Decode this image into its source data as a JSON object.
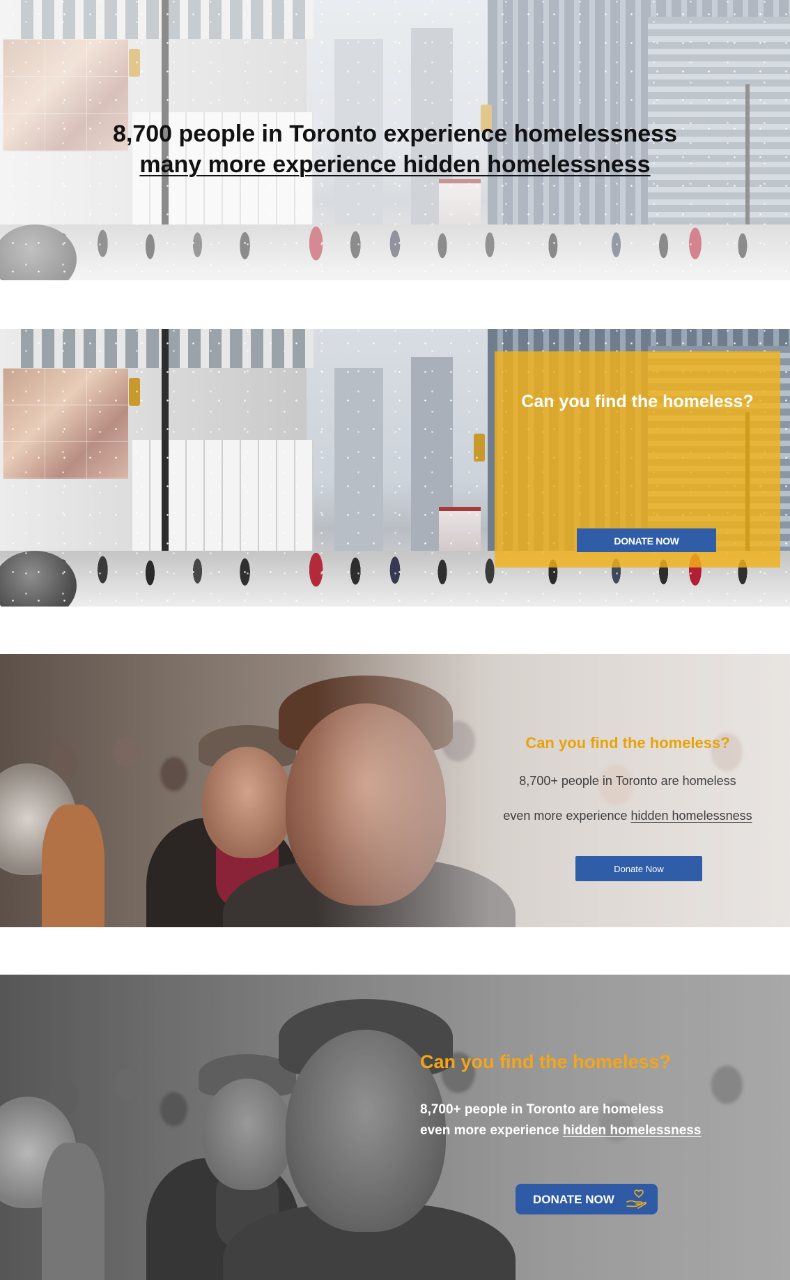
{
  "banner1": {
    "headline_line1": "8,700 people in Toronto experience homelessness",
    "headline_line2": "many more experience hidden homelessness"
  },
  "banner2": {
    "title": "Can you find the homeless?",
    "button_label": "DONATE NOW",
    "overlay_color": "#f2b21a",
    "button_color": "#2f5da8"
  },
  "banner3": {
    "title": "Can you find the homeless?",
    "line1": "8,700+ people in Toronto are homeless",
    "line2_prefix": "even more experience ",
    "line2_link": "hidden homelessness",
    "button_label": "Donate Now",
    "title_color": "#e8a30c",
    "button_color": "#2f5da8"
  },
  "banner4": {
    "title": "Can you find the homeless?",
    "line1": "8,700+ people in Toronto are homeless",
    "line2_prefix": "even more experience ",
    "line2_link": "hidden homelessness",
    "button_label": "DONATE NOW",
    "button_icon": "hand-heart-icon",
    "title_color": "#f4a51a",
    "button_color": "#2f5aa6"
  }
}
